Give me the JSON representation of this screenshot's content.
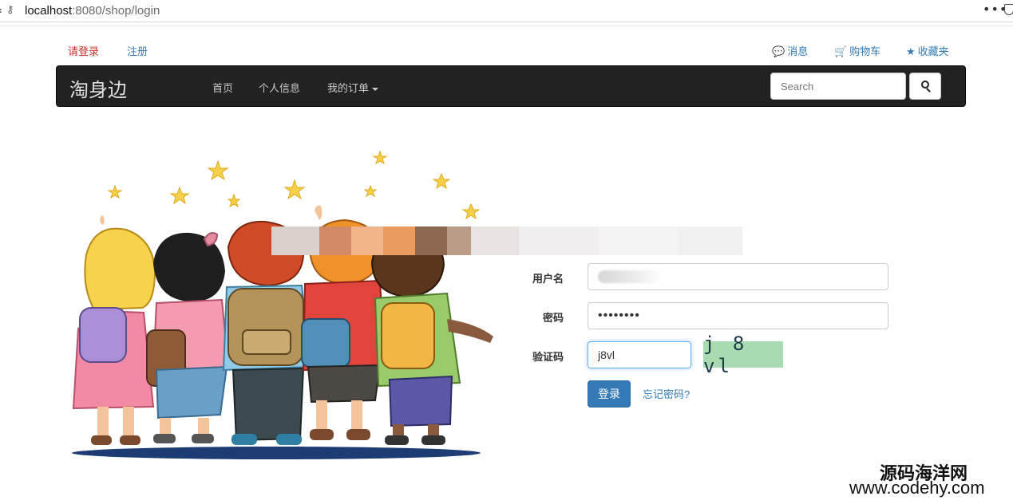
{
  "browser": {
    "url_host": "localhost",
    "url_rest": ":8080/shop/login",
    "menu_icon": "more-icon",
    "security_icon": "shield-icon"
  },
  "top_links": {
    "login": "请登录",
    "register": "注册",
    "messages": "消息",
    "cart": "购物车",
    "favorites": "收藏夹"
  },
  "navbar": {
    "brand": "淘身边",
    "items": [
      "首页",
      "个人信息",
      "我的订单"
    ],
    "search_placeholder": "Search"
  },
  "form": {
    "username_label": "用户名",
    "password_label": "密码",
    "password_value": "••••••••",
    "captcha_label": "验证码",
    "captcha_value": "j8vl",
    "captcha_image_text": "j 8 vl",
    "submit_label": "登录",
    "forgot_label": "忘记密码?"
  },
  "colors": {
    "navbar_bg": "#222222",
    "primary": "#337ab7",
    "login_link": "#c9302c",
    "captcha_bg": "#a8dcb0"
  },
  "watermark": {
    "line1": "源码海洋网",
    "line2": "www.codehy.com"
  }
}
